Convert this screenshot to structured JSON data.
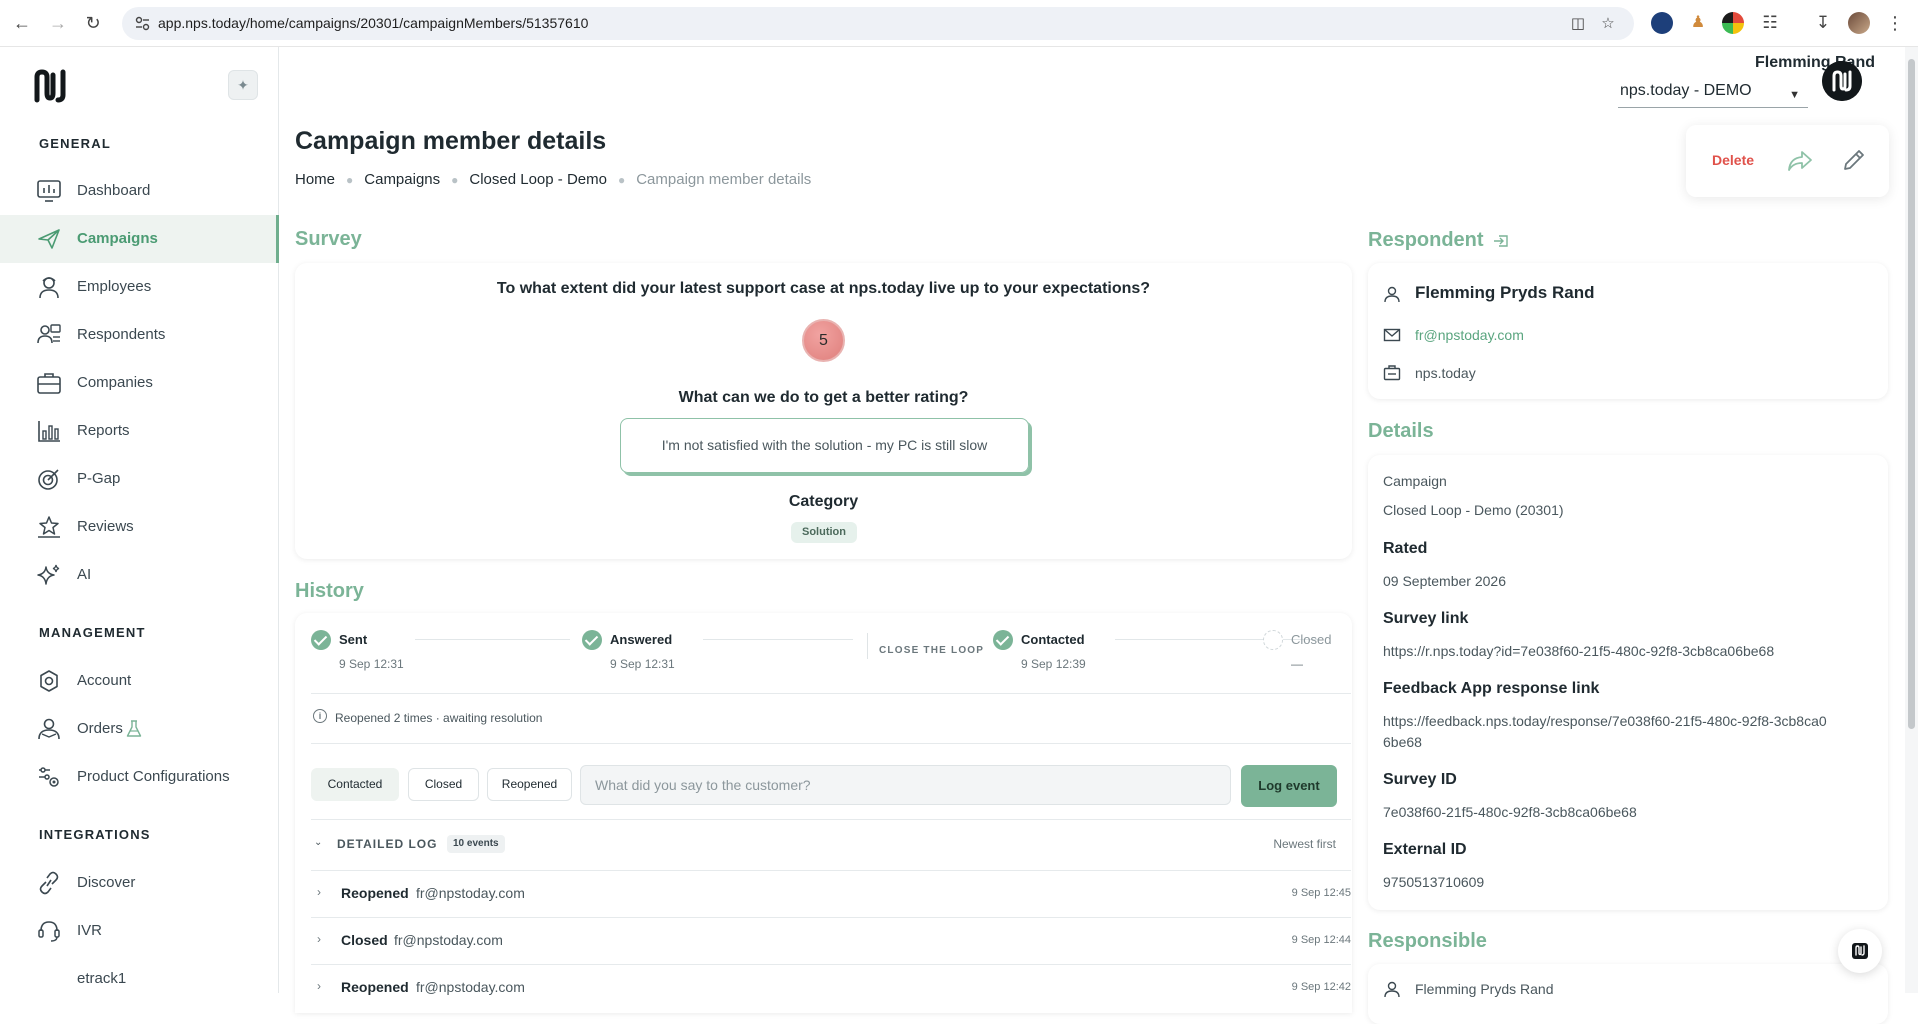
{
  "browser": {
    "url": "app.nps.today/home/campaigns/20301/campaignMembers/51357610"
  },
  "sidebar": {
    "sections": [
      {
        "title": "GENERAL"
      },
      {
        "title": "MANAGEMENT"
      },
      {
        "title": "INTEGRATIONS"
      }
    ],
    "general_items": [
      {
        "label": "Dashboard",
        "icon": "dashboard-icon"
      },
      {
        "label": "Campaigns",
        "icon": "rocket-icon",
        "active": true
      },
      {
        "label": "Employees",
        "icon": "employee-icon"
      },
      {
        "label": "Respondents",
        "icon": "respondents-icon"
      },
      {
        "label": "Companies",
        "icon": "briefcase-icon"
      },
      {
        "label": "Reports",
        "icon": "reports-icon"
      },
      {
        "label": "P-Gap",
        "icon": "target-icon"
      },
      {
        "label": "Reviews",
        "icon": "stars-icon"
      },
      {
        "label": "AI",
        "icon": "sparkle-icon"
      }
    ],
    "management_items": [
      {
        "label": "Account",
        "icon": "settings-icon"
      },
      {
        "label": "Orders",
        "icon": "orders-icon",
        "badge_icon": "flask-icon"
      },
      {
        "label": "Product Configurations",
        "icon": "config-icon"
      }
    ],
    "integration_items": [
      {
        "label": "Discover",
        "icon": "link-icon"
      },
      {
        "label": "IVR",
        "icon": "phone-icon"
      },
      {
        "label": "etrack1",
        "icon": ""
      }
    ]
  },
  "header": {
    "user_name": "Flemming Rand",
    "org": "nps.today - DEMO",
    "page_title": "Campaign member details",
    "breadcrumb": [
      "Home",
      "Campaigns",
      "Closed Loop - Demo",
      "Campaign member details"
    ],
    "delete_label": "Delete"
  },
  "survey": {
    "heading": "Survey",
    "question1": "To what extent did your latest support case at nps.today live up to your expectations?",
    "score": "5",
    "question2": "What can we do to get a better rating?",
    "answer": "I'm not satisfied with the solution - my PC is still slow",
    "category_label": "Category",
    "category": "Solution"
  },
  "history": {
    "heading": "History",
    "steps": [
      {
        "label": "Sent",
        "date": "9 Sep 12:31",
        "done": true
      },
      {
        "label": "Answered",
        "date": "9 Sep 12:31",
        "done": true
      },
      {
        "label": "Contacted",
        "date": "9 Sep 12:39",
        "done": true
      },
      {
        "label": "Closed",
        "date": "—",
        "done": false
      }
    ],
    "loop_label": "CLOSE THE LOOP",
    "info": "Reopened 2 times · awaiting resolution",
    "pills": [
      "Contacted",
      "Closed",
      "Reopened"
    ],
    "note_placeholder": "What did you say to the customer?",
    "log_button": "Log event",
    "log_title": "DETAILED LOG",
    "log_count": "10 events",
    "log_sort": "Newest first",
    "log": [
      {
        "event": "Reopened",
        "by": "fr@npstoday.com",
        "time": "9 Sep 12:45"
      },
      {
        "event": "Closed",
        "by": "fr@npstoday.com",
        "time": "9 Sep 12:44"
      },
      {
        "event": "Reopened",
        "by": "fr@npstoday.com",
        "time": "9 Sep 12:42"
      }
    ]
  },
  "respondent": {
    "heading": "Respondent",
    "name": "Flemming Pryds Rand",
    "email": "fr@npstoday.com",
    "company": "nps.today"
  },
  "details": {
    "heading": "Details",
    "campaign_label": "Campaign",
    "campaign": "Closed Loop - Demo (20301)",
    "rated_label": "Rated",
    "rated": "09 September 2026",
    "survey_link_label": "Survey link",
    "survey_link": "https://r.nps.today?id=7e038f60-21f5-480c-92f8-3cb8ca06be68",
    "feedback_label": "Feedback App response link",
    "feedback_link": "https://feedback.nps.today/response/7e038f60-21f5-480c-92f8-3cb8ca06be68",
    "survey_id_label": "Survey ID",
    "survey_id": "7e038f60-21f5-480c-92f8-3cb8ca06be68",
    "external_id_label": "External ID",
    "external_id": "9750513710609"
  },
  "responsible": {
    "heading": "Responsible",
    "name": "Flemming Pryds Rand"
  }
}
